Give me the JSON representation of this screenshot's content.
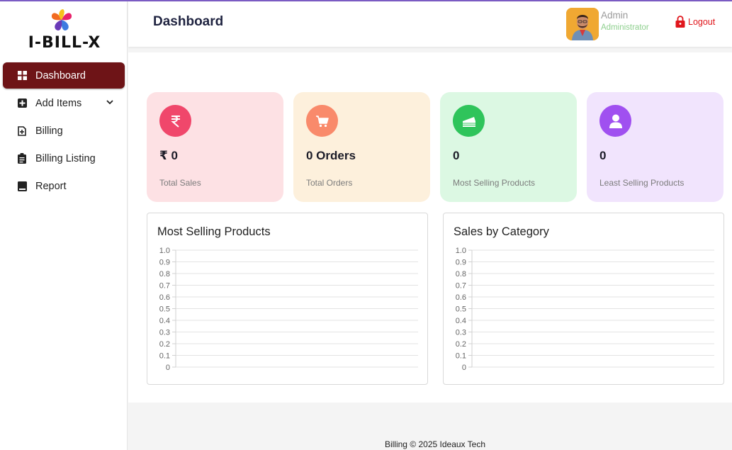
{
  "app": {
    "name": "I-BILL-X"
  },
  "sidebar": {
    "items": [
      {
        "label": "Dashboard",
        "icon": "dashboard-icon",
        "active": true
      },
      {
        "label": "Add Items",
        "icon": "plus-square-icon",
        "has_submenu": true
      },
      {
        "label": "Billing",
        "icon": "document-plus-icon"
      },
      {
        "label": "Billing Listing",
        "icon": "clipboard-icon"
      },
      {
        "label": "Report",
        "icon": "book-icon"
      }
    ]
  },
  "header": {
    "title": "Dashboard",
    "user": {
      "name": "Admin",
      "role": "Administrator"
    },
    "logout_label": "Logout"
  },
  "cards": [
    {
      "value": "₹ 0",
      "label": "Total Sales",
      "icon": "rupee-icon",
      "bg": "#fde1e4",
      "icon_bg": "#f0476b"
    },
    {
      "value": "0 Orders",
      "label": "Total Orders",
      "icon": "cart-icon",
      "bg": "#fdf0dc",
      "icon_bg": "#f98a6b"
    },
    {
      "value": "0",
      "label": "Most Selling Products",
      "icon": "cake-icon",
      "bg": "#dcf8e3",
      "icon_bg": "#2fc45b"
    },
    {
      "value": "0",
      "label": "Least Selling Products",
      "icon": "user-icon",
      "bg": "#f1e4fd",
      "icon_bg": "#a050f0"
    }
  ],
  "chart_data": [
    {
      "type": "bar",
      "title": "Most Selling Products",
      "categories": [],
      "values": [],
      "ylim": [
        0,
        1.0
      ],
      "yticks": [
        "1.0",
        "0.9",
        "0.8",
        "0.7",
        "0.6",
        "0.5",
        "0.4",
        "0.3",
        "0.2",
        "0.1",
        "0"
      ],
      "grid": true
    },
    {
      "type": "bar",
      "title": "Sales by Category",
      "categories": [],
      "values": [],
      "ylim": [
        0,
        1.0
      ],
      "yticks": [
        "1.0",
        "0.9",
        "0.8",
        "0.7",
        "0.6",
        "0.5",
        "0.4",
        "0.3",
        "0.2",
        "0.1",
        "0"
      ],
      "grid": true
    }
  ],
  "footer": {
    "text": "Billing © 2025 Ideaux Tech"
  }
}
